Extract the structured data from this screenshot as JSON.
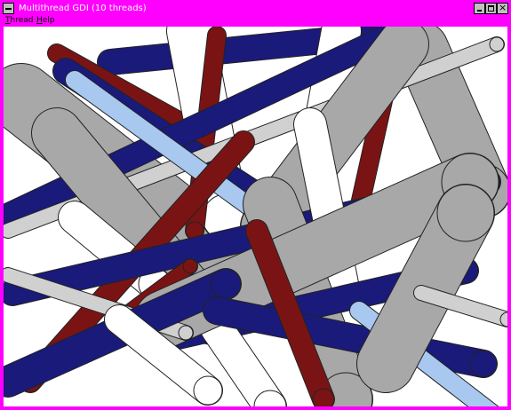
{
  "window": {
    "title": "Multithread GDI (10 threads)",
    "frame_color": "#ff00ff",
    "controls": [
      "minimize-button",
      "maximize-button",
      "close-button"
    ]
  },
  "menubar": {
    "items": [
      {
        "label_first": "T",
        "label_rest": "hread"
      },
      {
        "label_first": "H",
        "label_rest": "elp"
      }
    ]
  },
  "canvas": {
    "background": "#ffffff",
    "tube_colors": {
      "gray": "#a8a8a8",
      "navy": "#1a1a7a",
      "maroon": "#7a1414",
      "white": "#ffffff",
      "light_blue": "#a8c8f0",
      "light_gray": "#d0d0d0"
    }
  }
}
